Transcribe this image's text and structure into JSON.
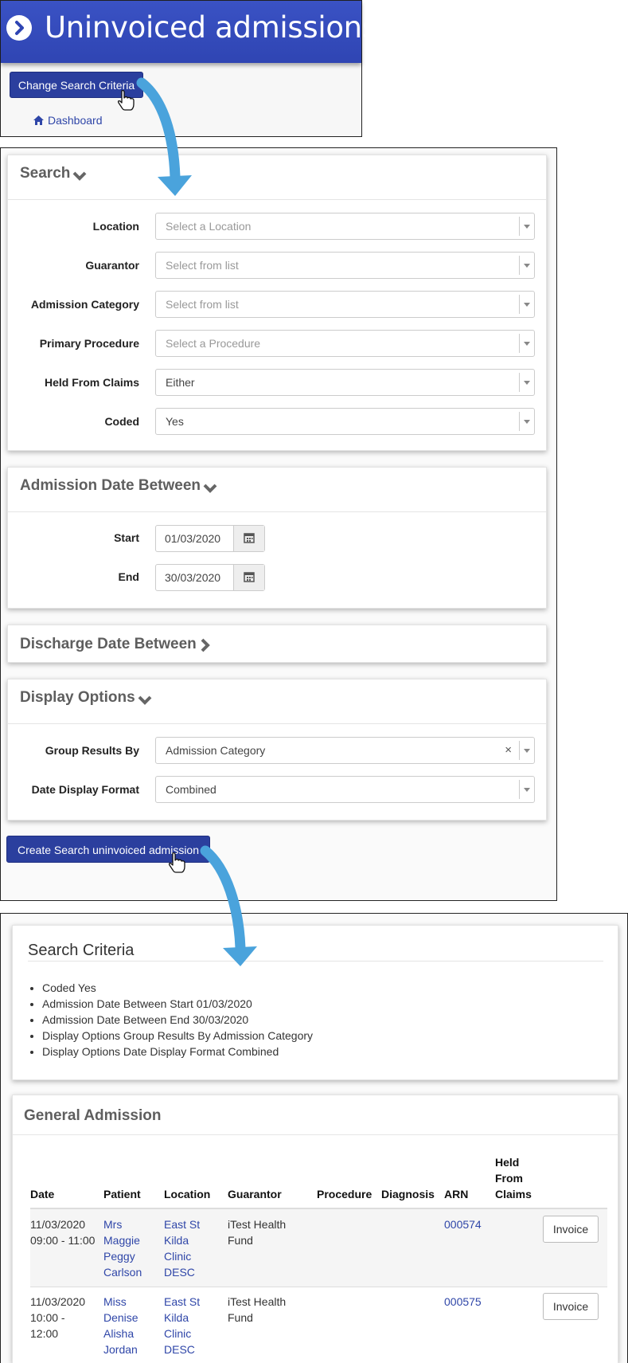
{
  "header": {
    "title": "Uninvoiced admissions",
    "change_button": "Change Search Criteria",
    "dashboard_link": "Dashboard"
  },
  "search": {
    "heading": "Search",
    "fields": [
      {
        "label": "Location",
        "value": "Select a Location",
        "placeholder": true
      },
      {
        "label": "Guarantor",
        "value": "Select from list",
        "placeholder": true
      },
      {
        "label": "Admission Category",
        "value": "Select from list",
        "placeholder": true
      },
      {
        "label": "Primary Procedure",
        "value": "Select a Procedure",
        "placeholder": true
      },
      {
        "label": "Held From Claims",
        "value": "Either",
        "placeholder": false
      },
      {
        "label": "Coded",
        "value": "Yes",
        "placeholder": false
      }
    ]
  },
  "admission_date": {
    "heading": "Admission Date Between",
    "start_label": "Start",
    "start_value": "01/03/2020",
    "end_label": "End",
    "end_value": "30/03/2020"
  },
  "discharge_date": {
    "heading": "Discharge Date Between"
  },
  "display_options": {
    "heading": "Display Options",
    "group_label": "Group Results By",
    "group_value": "Admission Category",
    "clear_symbol": "×",
    "format_label": "Date Display Format",
    "format_value": "Combined"
  },
  "create_button": "Create Search uninvoiced admission",
  "criteria": {
    "heading": "Search Criteria",
    "items": [
      "Coded Yes",
      "Admission Date Between Start 01/03/2020",
      "Admission Date Between End 30/03/2020",
      "Display Options Group Results By Admission Category",
      "Display Options Date Display Format Combined"
    ]
  },
  "results": {
    "heading": "General Admission",
    "columns": [
      "Date",
      "Patient",
      "Location",
      "Guarantor",
      "Procedure",
      "Diagnosis",
      "ARN",
      "Held From Claims"
    ],
    "rows": [
      {
        "date": "11/03/2020 09:00 - 11:00",
        "patient": "Mrs Maggie Peggy Carlson",
        "location": "East St Kilda Clinic DESC",
        "guarantor": "iTest Health Fund",
        "procedure": "",
        "diagnosis": "",
        "arn": "000574",
        "held": "",
        "action": "Invoice"
      },
      {
        "date": "11/03/2020 10:00 - 12:00",
        "patient": "Miss Denise Alisha Jordan",
        "location": "East St Kilda Clinic DESC",
        "guarantor": "iTest Health Fund",
        "procedure": "",
        "diagnosis": "",
        "arn": "000575",
        "held": "",
        "action": "Invoice"
      }
    ]
  },
  "colors": {
    "header_blue": "#3a52c4",
    "button_blue": "#2b3f9e",
    "link_blue": "#2f46a8",
    "arrow_blue": "#4aa3dc"
  }
}
